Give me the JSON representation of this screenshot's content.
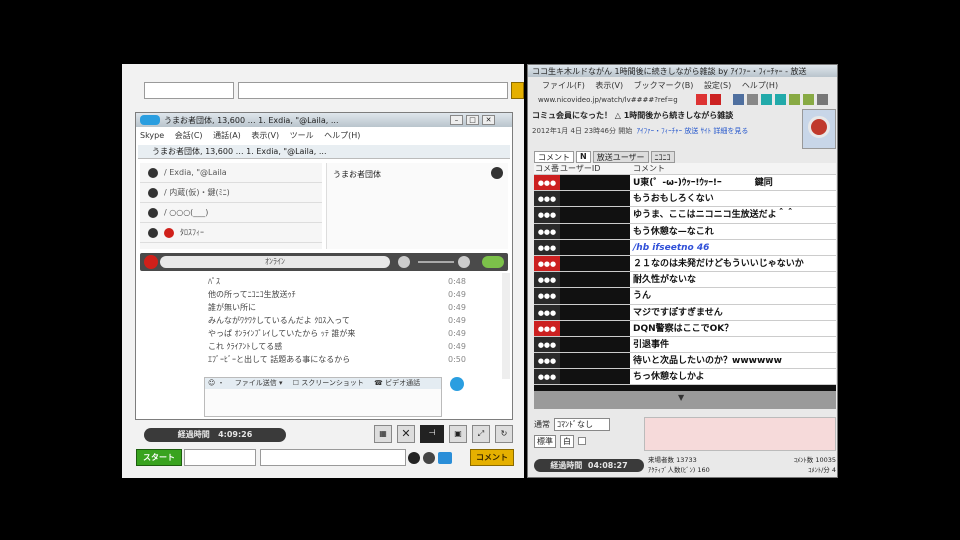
{
  "left_window": {
    "bottom_elapsed_label": "経過時間",
    "bottom_elapsed_time": "4:09:26",
    "start_button": "スタート",
    "comment_button": "コメント"
  },
  "skype": {
    "title": "うまお者団体, 13,600 … 1. Exdia, \"@Laila, ...",
    "menu": [
      "Skype",
      "会話(C)",
      "通話(A)",
      "表示(V)",
      "ツール",
      "ヘルプ(H)"
    ],
    "tab_label": "うまお者団体, 13,600 … 1. Exdia, \"@Laila, ...",
    "contacts": [
      "/ Exdia, \"@Laila",
      "/ 内蔵(仮)・鍵(ﾐﾆ)",
      "/ ○○○(___)",
      "ﾀﾛｽﾌｨｰ"
    ],
    "group_name": "うまお者団体",
    "call_bar_label": "ｵﾝﾗｲﾝ",
    "chat_lines": [
      {
        "text": "ﾊﾟｽ",
        "time": "0:48"
      },
      {
        "text": "他の所ってﾆｺﾆｺ生放送ｩﾁ",
        "time": "0:49"
      },
      {
        "text": "誰が無い所に",
        "time": "0:49"
      },
      {
        "text": "みんながﾜｸﾜｸしているんだよ ｸﾛｽ入って",
        "time": "0:49"
      },
      {
        "text": "やっぱ ｵﾝﾗｲﾝﾌﾟﾚｲしていたから ｯﾃ 誰が来",
        "time": "0:49"
      },
      {
        "text": "これ ｸﾗｲｱﾝﾄしてる感",
        "time": "0:49"
      },
      {
        "text": "ｴﾌﾞｰﾋﾞｰと出して 話題ある事になるから",
        "time": "0:50"
      }
    ],
    "input_toolbar": [
      "☺ ・",
      "ファイル送信 ▾",
      "☐ スクリーンショット",
      "☎ ビデオ通話"
    ]
  },
  "nico": {
    "title": "ココ生キ木ルドながん 1時間後に続きしながら雑談 by ｱｲﾌｧｰ・ﾌｨｰﾁｬｰ - 放送",
    "menu": [
      "ファイル(F)",
      "表示(V)",
      "ブックマーク(B)",
      "設定(S)",
      "ヘルプ(H)"
    ],
    "url": "www.nicovideo.jp/watch/lv####?ref=grid",
    "notice": "コミュ会員になった！",
    "broadcast_title": "△ 1時間後から続きしながら雑談",
    "date_info": "2012年1月 4日 23時46分 開始",
    "broadcaster_link": "ｱｲﾌｧｰ・ﾌｨｰﾁｬｰ 放送 ｻｲﾄ 詳細を見る",
    "tabs": [
      "コメント",
      "N",
      "放送ユーザー",
      "ﾆｺﾆｺ"
    ],
    "columns": [
      "コメ番",
      "ユーザーID",
      "コメント"
    ],
    "comments": [
      {
        "num": "●●●",
        "badge": "red",
        "text": "U東(゜-ω-)ｳｯｰ!ｳｯｰ!ｰ  　　　 鍵同"
      },
      {
        "num": "●●●",
        "badge": "dark",
        "text": "もうおもしろくない"
      },
      {
        "num": "●●●",
        "badge": "dark",
        "text": "ゆうま、ここはニコニコ生放送だよ＾＾"
      },
      {
        "num": "●●●",
        "badge": "dark",
        "text": "もう休憩な—なこれ"
      },
      {
        "num": "●●●",
        "badge": "dark",
        "text": "/hb ifseetno 46"
      },
      {
        "num": "●●●",
        "badge": "red",
        "text": "２１なのは未発だけどもういいじゃないか"
      },
      {
        "num": "●●●",
        "badge": "dark",
        "text": "耐久性がないな"
      },
      {
        "num": "●●●",
        "badge": "dark",
        "text": "うん"
      },
      {
        "num": "●●●",
        "badge": "dark",
        "text": "マジですぽすぎません"
      },
      {
        "num": "●●●",
        "badge": "red",
        "text": "DQN警察はここでOK？"
      },
      {
        "num": "●●●",
        "badge": "dark",
        "text": "引退事件"
      },
      {
        "num": "●●●",
        "badge": "dark",
        "text": "待いと次品したいのか？wwwwww"
      },
      {
        "num": "●●●",
        "badge": "dark",
        "text": "ちっ休憩なしかよ"
      }
    ],
    "post_controls": {
      "mode": "通常",
      "command": "ｺﾏﾝﾄﾞなし",
      "size": "標準",
      "color": "白"
    },
    "elapsed_label": "経過時間",
    "elapsed_time": "04:08:27",
    "stats": [
      {
        "label": "来場者数",
        "value": "13733"
      },
      {
        "label": "ｺﾒﾝﾄ数",
        "value": "10035"
      },
      {
        "label": "ｱｸﾃｨﾌﾞ人数(ﾋﾞﾝ)",
        "value": "160"
      },
      {
        "label": "ｺﾒﾝﾄ/分",
        "value": "4"
      }
    ]
  }
}
